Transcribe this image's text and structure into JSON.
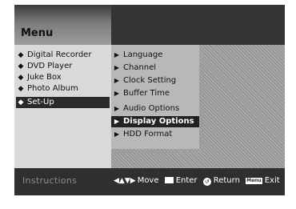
{
  "header": {
    "title": "Menu"
  },
  "left_menu": {
    "bullet_icon": "diamond-bullet-icon",
    "items": [
      {
        "label": "Digital Recorder",
        "selected": false
      },
      {
        "label": "DVD Player",
        "selected": false
      },
      {
        "label": "Juke Box",
        "selected": false
      },
      {
        "label": "Photo Album",
        "selected": false
      },
      {
        "label": "Set-Up",
        "selected": true
      }
    ]
  },
  "submenu": {
    "arrow_icon": "submenu-arrow-icon",
    "items": [
      {
        "label": "Language",
        "selected": false
      },
      {
        "label": "Channel",
        "selected": false
      },
      {
        "label": "Clock Setting",
        "selected": false
      },
      {
        "label": "Buffer Time",
        "selected": false
      },
      {
        "label": "Audio Options",
        "selected": false
      },
      {
        "label": "Display Options",
        "selected": true
      },
      {
        "label": "HDD Format",
        "selected": false
      }
    ]
  },
  "instructions": {
    "label": "Instructions",
    "move": "Move",
    "enter": "Enter",
    "return": "Return",
    "menu_key": "Menu",
    "exit": "Exit"
  },
  "colors": {
    "background": "#2e2e2e",
    "left_panel": "#d9d9d9",
    "submenu_panel": "#b8b8b8",
    "selected": "#222222",
    "selected_text": "#ffffff"
  }
}
